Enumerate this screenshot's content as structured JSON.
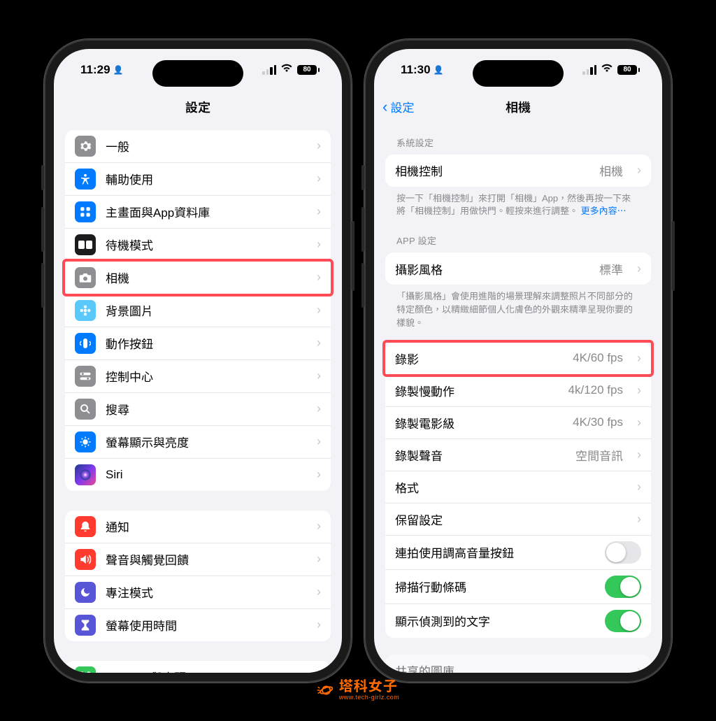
{
  "status": {
    "time_left": "11:29",
    "time_right": "11:30",
    "battery": "80"
  },
  "left": {
    "title": "設定",
    "section1": [
      {
        "label": "一般",
        "icon": "gear",
        "cls": "ic-gray"
      },
      {
        "label": "輔助使用",
        "icon": "accessibility",
        "cls": "ic-blue"
      },
      {
        "label": "主畫面與App資料庫",
        "icon": "grid",
        "cls": "ic-blue"
      },
      {
        "label": "待機模式",
        "icon": "standby",
        "cls": "ic-dark"
      },
      {
        "label": "相機",
        "icon": "camera",
        "cls": "ic-gray",
        "highlight": true
      },
      {
        "label": "背景圖片",
        "icon": "flower",
        "cls": "ic-cyan"
      },
      {
        "label": "動作按鈕",
        "icon": "action",
        "cls": "ic-blue"
      },
      {
        "label": "控制中心",
        "icon": "switches",
        "cls": "ic-gray"
      },
      {
        "label": "搜尋",
        "icon": "search",
        "cls": "ic-gray"
      },
      {
        "label": "螢幕顯示與亮度",
        "icon": "brightness",
        "cls": "ic-blue"
      },
      {
        "label": "Siri",
        "icon": "siri",
        "cls": "ic-grad"
      }
    ],
    "section2": [
      {
        "label": "通知",
        "icon": "bell",
        "cls": "ic-red"
      },
      {
        "label": "聲音與觸覺回饋",
        "icon": "sound",
        "cls": "ic-red"
      },
      {
        "label": "專注模式",
        "icon": "moon",
        "cls": "ic-purple"
      },
      {
        "label": "螢幕使用時間",
        "icon": "hourglass",
        "cls": "ic-purple"
      }
    ],
    "section3_peek": {
      "label": "Face ID 與密碼",
      "icon": "faceid",
      "cls": "ic-green"
    }
  },
  "right": {
    "back": "設定",
    "title": "相機",
    "group1_header": "系統設定",
    "group1": [
      {
        "label": "相機控制",
        "value": "相機"
      }
    ],
    "group1_footer_text": "按一下「相機控制」來打開「相機」App，然後再按一下來將「相機控制」用做快門。輕按來進行調整。",
    "group1_footer_link": "更多內容⋯",
    "group2_header": "APP 設定",
    "group2_row": {
      "label": "攝影風格",
      "value": "標準"
    },
    "group2_footer": "「攝影風格」會使用進階的場景理解來調整照片不同部分的特定顏色，以精緻細節個人化膚色的外觀來精準呈現你要的樣貌。",
    "group3": [
      {
        "label": "錄影",
        "value": "4K/60 fps",
        "highlight": true
      },
      {
        "label": "錄製慢動作",
        "value": "4k/120 fps"
      },
      {
        "label": "錄製電影級",
        "value": "4K/30 fps"
      },
      {
        "label": "錄製聲音",
        "value": "空間音訊"
      },
      {
        "label": "格式",
        "value": ""
      },
      {
        "label": "保留設定",
        "value": ""
      }
    ],
    "group3_toggles": [
      {
        "label": "連拍使用調高音量按鈕",
        "on": false
      },
      {
        "label": "掃描行動條碼",
        "on": true
      },
      {
        "label": "顯示偵測到的文字",
        "on": true
      }
    ],
    "peek": "共享的圖庫"
  },
  "brand": {
    "main": "塔科女子",
    "sub": "www.tech-girlz.com"
  }
}
